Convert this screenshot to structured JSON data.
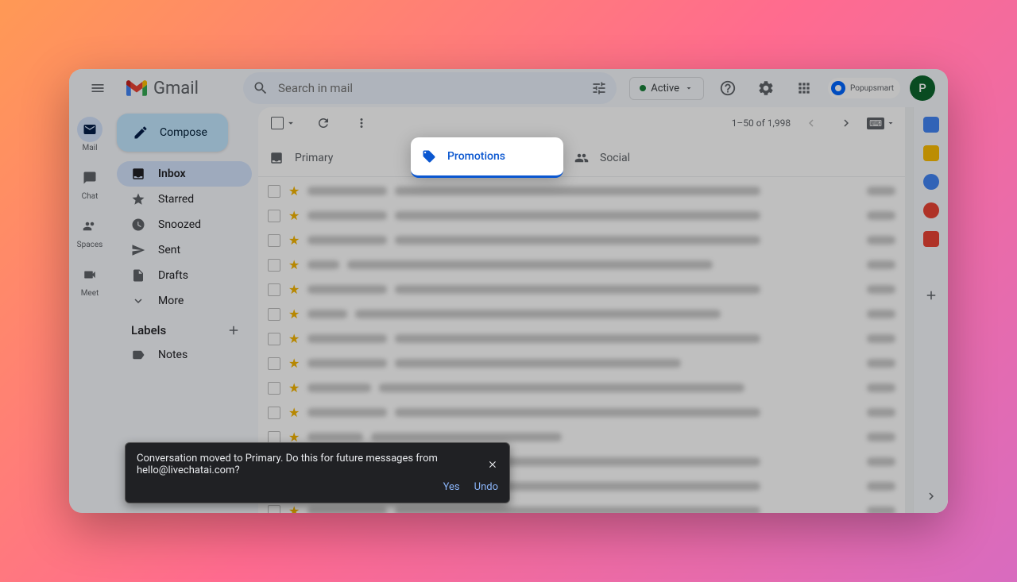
{
  "app": {
    "name": "Gmail"
  },
  "search": {
    "placeholder": "Search in mail"
  },
  "status": {
    "active_label": "Active"
  },
  "brand": {
    "label": "Popupsmart"
  },
  "avatar": {
    "initial": "P"
  },
  "compose": {
    "label": "Compose"
  },
  "rail": {
    "mail": "Mail",
    "chat": "Chat",
    "spaces": "Spaces",
    "meet": "Meet"
  },
  "nav": {
    "inbox": "Inbox",
    "starred": "Starred",
    "snoozed": "Snoozed",
    "sent": "Sent",
    "drafts": "Drafts",
    "more": "More"
  },
  "labels": {
    "header": "Labels",
    "notes": "Notes"
  },
  "tabs": {
    "primary": "Primary",
    "promotions": "Promotions",
    "social": "Social"
  },
  "pagination": {
    "range": "1–50 of 1,998"
  },
  "toast": {
    "message": "Conversation moved to Primary. Do this for future messages from hello@livechatai.com?",
    "yes": "Yes",
    "undo": "Undo"
  }
}
